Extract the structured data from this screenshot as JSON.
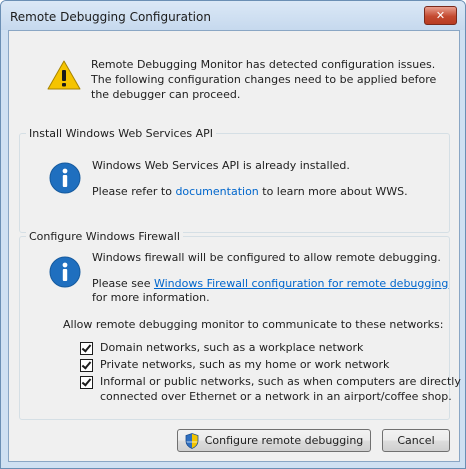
{
  "window": {
    "title": "Remote Debugging Configuration",
    "close_label": "✕"
  },
  "intro": {
    "line1": "Remote Debugging Monitor has detected configuration issues.",
    "line2": "The following configuration changes need to be applied before",
    "line3": "the debugger can proceed."
  },
  "wws": {
    "group_label": "Install Windows Web Services API",
    "status": "Windows Web Services API is already installed.",
    "refer_prefix": "Please refer to ",
    "refer_link": "documentation",
    "refer_suffix": " to learn more about WWS."
  },
  "firewall": {
    "group_label": "Configure Windows Firewall",
    "status": "Windows firewall will be configured to allow remote debugging.",
    "see_prefix": "Please see ",
    "see_link": "Windows Firewall configuration for remote debugging",
    "see_suffix": "for more information.",
    "networks_prompt": "Allow remote debugging monitor to communicate to these networks:",
    "networks": [
      {
        "lines": [
          "Domain networks, such as a workplace network"
        ],
        "checked": true
      },
      {
        "lines": [
          "Private networks, such as my home or work network"
        ],
        "checked": true
      },
      {
        "lines": [
          "Informal or public networks, such as when computers are directly",
          "connected over Ethernet or a network in an airport/coffee shop."
        ],
        "checked": true
      }
    ]
  },
  "buttons": {
    "configure": "Configure remote debugging",
    "cancel": "Cancel"
  },
  "icons": {
    "warning": "warning-icon",
    "info": "info-icon",
    "shield": "uac-shield-icon",
    "close": "close-icon"
  },
  "colors": {
    "link": "#0066cc",
    "info_icon": "#1f6fbf",
    "warning_icon": "#f5c400",
    "close_button": "#c44a30"
  }
}
